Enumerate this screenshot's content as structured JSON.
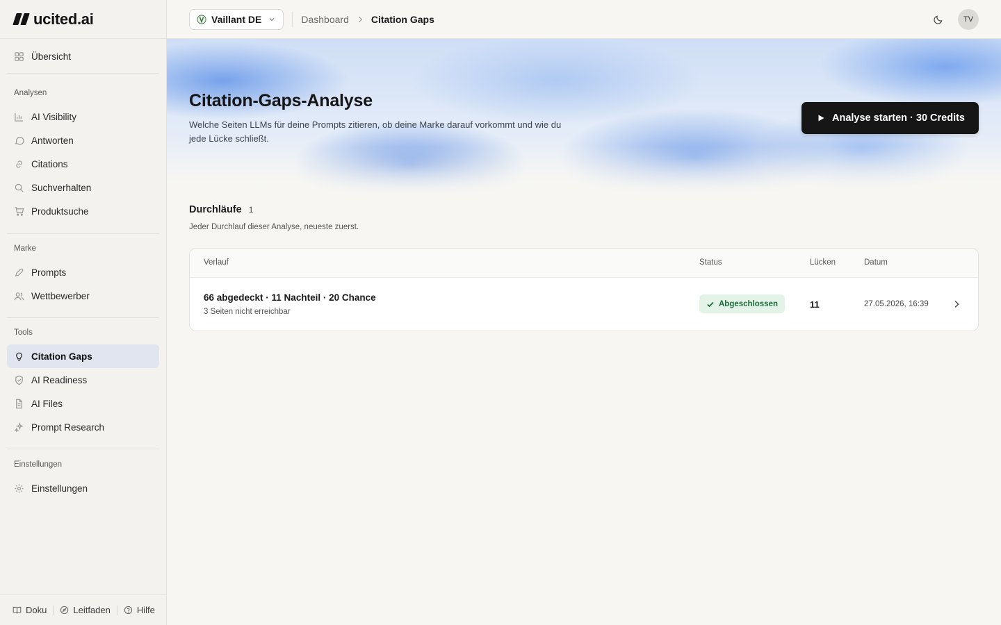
{
  "app": {
    "name": "ucited.ai"
  },
  "sidebar": {
    "overview": "Übersicht",
    "sections": {
      "analysen": "Analysen",
      "marke": "Marke",
      "tools": "Tools",
      "einstellungen": "Einstellungen"
    },
    "items": {
      "ai_visibility": "AI Visibility",
      "antworten": "Antworten",
      "citations": "Citations",
      "suchverhalten": "Suchverhalten",
      "produktsuche": "Produktsuche",
      "prompts": "Prompts",
      "wettbewerber": "Wettbewerber",
      "citation_gaps": "Citation Gaps",
      "ai_readiness": "AI Readiness",
      "ai_files": "AI Files",
      "prompt_research": "Prompt Research",
      "einstellungen": "Einstellungen"
    },
    "active": "citation_gaps",
    "footer": {
      "doku": "Doku",
      "leitfaden": "Leitfaden",
      "hilfe": "Hilfe"
    }
  },
  "topbar": {
    "brand": "Vaillant DE",
    "breadcrumb": [
      "Dashboard",
      "Citation Gaps"
    ],
    "avatar_initials": "TV"
  },
  "hero": {
    "title": "Citation-Gaps-Analyse",
    "subtitle": "Welche Seiten LLMs für deine Prompts zitieren, ob deine Marke darauf vorkommt und wie du jede Lücke schließt.",
    "cta": "Analyse starten · 30 Credits"
  },
  "runs": {
    "title": "Durchläufe",
    "count": "1",
    "description": "Jeder Durchlauf dieser Analyse, neueste zuerst.",
    "columns": {
      "verlauf": "Verlauf",
      "status": "Status",
      "luecken": "Lücken",
      "datum": "Datum"
    },
    "rows": [
      {
        "summary": "66 abgedeckt · 11 Nachteil · 20 Chance",
        "detail": "3 Seiten nicht erreichbar",
        "status": "Abgeschlossen",
        "gaps": "11",
        "date": "27.05.2026, 16:39"
      }
    ]
  },
  "colors": {
    "accent_dark": "#161616",
    "active_nav_bg": "#e1e5ef",
    "status_success_bg": "#e3f3e8",
    "status_success_fg": "#1b6b3a"
  }
}
